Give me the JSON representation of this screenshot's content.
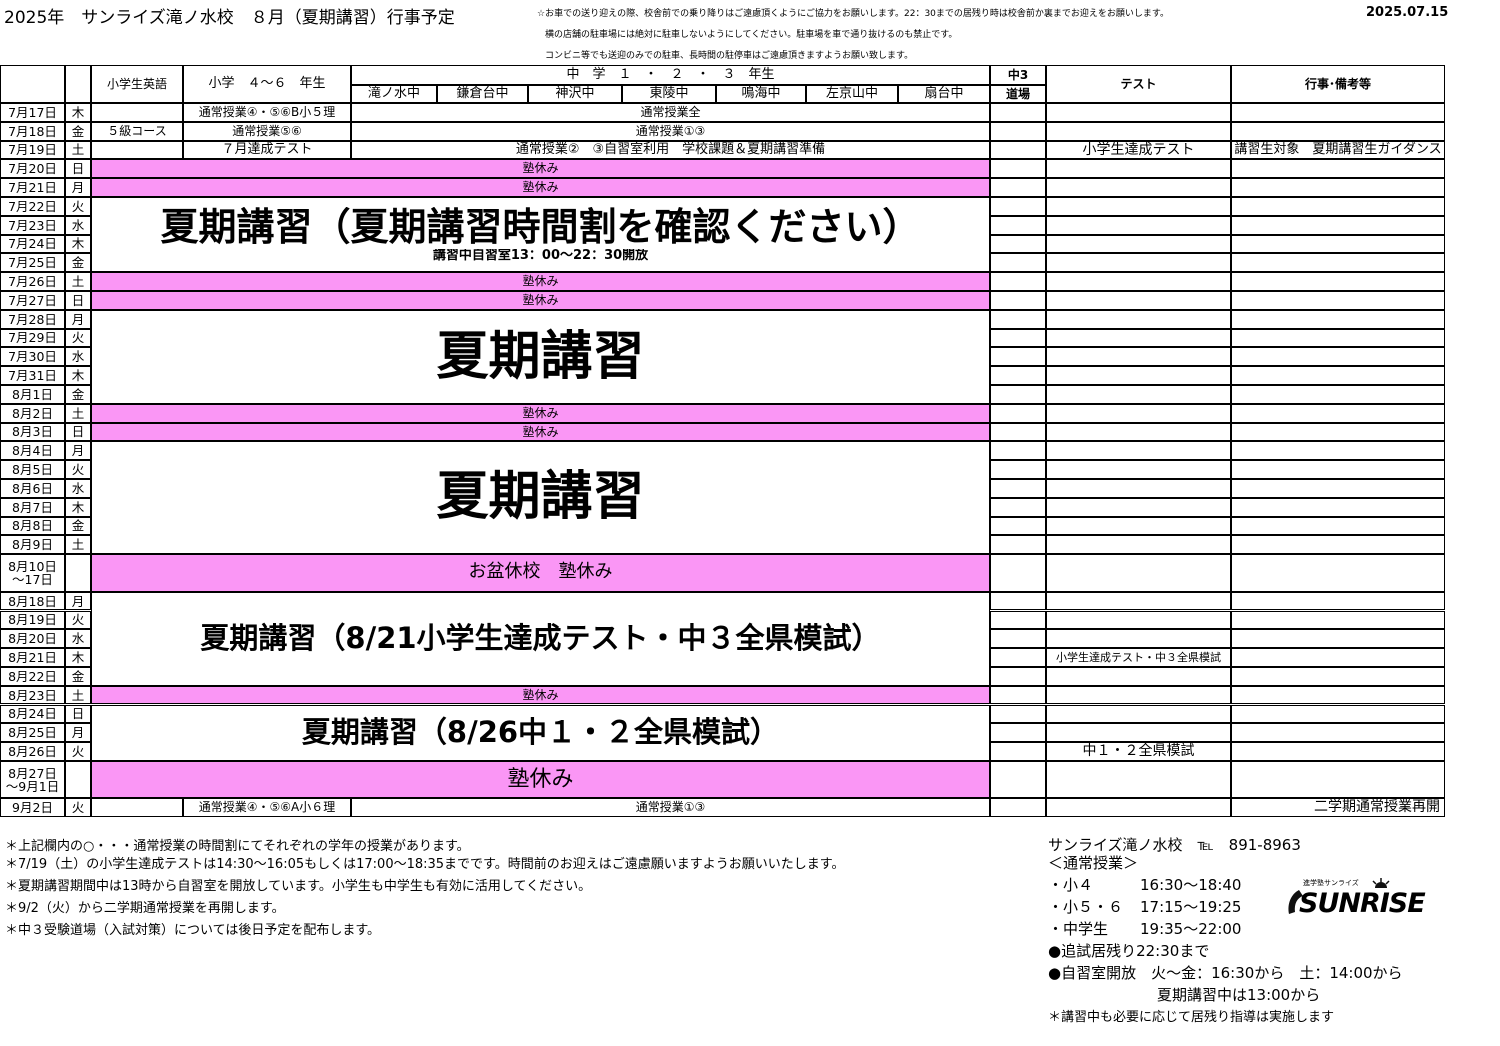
{
  "header": {
    "title": "2025年　サンライズ滝ノ水校　８月（夏期講習）行事予定",
    "notice_lines": [
      "☆お車での送り迎えの際、校舎前での乗り降りはご遠慮頂くようにご協力をお願いします。22：30までの居残り時は校舎前か裏までお迎えをお願いします。",
      "横の店舗の駐車場には絶対に駐車しないようにしてください。駐車場を車で通り抜けるのも禁止です。",
      "コンビニ等でも送迎のみでの駐車、長時間の駐停車はご遠慮頂きますようお願い致します。"
    ],
    "date": "2025.07.15"
  },
  "table_header": {
    "elem_english": "小学生英語",
    "elem_46": "小学　４～６　年生",
    "jh": "中　学　１　・　２　・　３　年生",
    "schools": [
      "滝ノ水中",
      "鎌倉台中",
      "神沢中",
      "東陵中",
      "鳴海中",
      "左京山中",
      "扇台中"
    ],
    "dojo_l1": "中3",
    "dojo_l2": "道場",
    "test": "テスト",
    "events": "行事･備考等"
  },
  "rows": [
    {
      "date": "7月17日",
      "dow": "木"
    },
    {
      "date": "7月18日",
      "dow": "金"
    },
    {
      "date": "7月19日",
      "dow": "土"
    },
    {
      "date": "7月20日",
      "dow": "日"
    },
    {
      "date": "7月21日",
      "dow": "月"
    },
    {
      "date": "7月22日",
      "dow": "火"
    },
    {
      "date": "7月23日",
      "dow": "水"
    },
    {
      "date": "7月24日",
      "dow": "木"
    },
    {
      "date": "7月25日",
      "dow": "金"
    },
    {
      "date": "7月26日",
      "dow": "土"
    },
    {
      "date": "7月27日",
      "dow": "日"
    },
    {
      "date": "7月28日",
      "dow": "月"
    },
    {
      "date": "7月29日",
      "dow": "火"
    },
    {
      "date": "7月30日",
      "dow": "水"
    },
    {
      "date": "7月31日",
      "dow": "木"
    },
    {
      "date": "8月1日",
      "dow": "金"
    },
    {
      "date": "8月2日",
      "dow": "土"
    },
    {
      "date": "8月3日",
      "dow": "日"
    },
    {
      "date": "8月4日",
      "dow": "月"
    },
    {
      "date": "8月5日",
      "dow": "火"
    },
    {
      "date": "8月6日",
      "dow": "水"
    },
    {
      "date": "8月7日",
      "dow": "木"
    },
    {
      "date": "8月8日",
      "dow": "金"
    },
    {
      "date": "8月9日",
      "dow": "土"
    },
    {
      "date": "8月10日\n～17日",
      "dow": ""
    },
    {
      "date": "8月18日",
      "dow": "月"
    },
    {
      "date": "8月19日",
      "dow": "火"
    },
    {
      "date": "8月20日",
      "dow": "水"
    },
    {
      "date": "8月21日",
      "dow": "木"
    },
    {
      "date": "8月22日",
      "dow": "金"
    },
    {
      "date": "8月23日",
      "dow": "土"
    },
    {
      "date": "8月24日",
      "dow": "日"
    },
    {
      "date": "8月25日",
      "dow": "月"
    },
    {
      "date": "8月26日",
      "dow": "火"
    },
    {
      "date": "8月27日\n～9月1日",
      "dow": ""
    },
    {
      "date": "9月2日",
      "dow": "火"
    }
  ],
  "cells": {
    "r0_elem46": "通常授業④・⑤⑥B小５理",
    "r0_jh": "通常授業全",
    "r1_eng": "５級コース",
    "r1_elem46": "通常授業⑤⑥",
    "r1_jh": "通常授業①③",
    "r2_elem46": "７月達成テスト",
    "r2_jh": "通常授業②　③自習室利用　学校課題＆夏期講習準備",
    "r2_test": "小学生達成テスト",
    "r2_events": "講習生対象　夏期講習生ガイダンス",
    "closed": "塾休み",
    "summer1_big": "夏期講習（夏期講習時間割を確認ください）",
    "summer1_sub": "講習中自習室13：00～22：30開放",
    "summer2": "夏期講習",
    "summer3": "夏期講習",
    "obon": "お盆休校　塾休み",
    "summer4": "夏期講習（8/21小学生達成テスト・中３全県模試）",
    "r28_test": "小学生達成テスト・中３全県模試",
    "summer5": "夏期講習（8/26中１・２全県模試）",
    "r33_test": "中１・２全県模試",
    "closed_big": "塾休み",
    "r35_elem46": "通常授業④・⑤⑥A小６理",
    "r35_jh": "通常授業①③",
    "r35_events": "二学期通常授業再開"
  },
  "notes": [
    "＊上記欄内の○・・・通常授業の時間割にてそれぞれの学年の授業があります。",
    "＊7/19（土）の小学生達成テストは14:30～16:05もしくは17:00～18:35までです。時間前のお迎えはご遠慮願いますようお願いいたします。",
    "＊夏期講習期間中は13時から自習室を開放しています。小学生も中学生も有効に活用してください。",
    "＊9/2（火）から二学期通常授業を再開します。",
    "＊中３受験道場（入試対策）については後日予定を配布します。"
  ],
  "contact": {
    "school": "サンライズ滝ノ水校　℡　891-8963",
    "regular_heading": "＜通常授業＞",
    "lines": [
      {
        "label": "・小４",
        "time": "16:30～18:40"
      },
      {
        "label": "・小５・６",
        "time": "17:15～19:25"
      },
      {
        "label": "・中学生",
        "time": "19:35～22:00"
      }
    ],
    "extra1": "●追試居残り22:30まで",
    "extra2": "●自習室開放　火～金：16:30から　土：14:00から",
    "extra3": "夏期講習中は13:00から",
    "extra4": "＊講習中も必要に応じて居残り指導は実施します"
  },
  "logo": {
    "small": "進学塾サンライズ",
    "main": "SUNRISE"
  },
  "colors": {
    "closed_bg": "#fa96f5"
  }
}
